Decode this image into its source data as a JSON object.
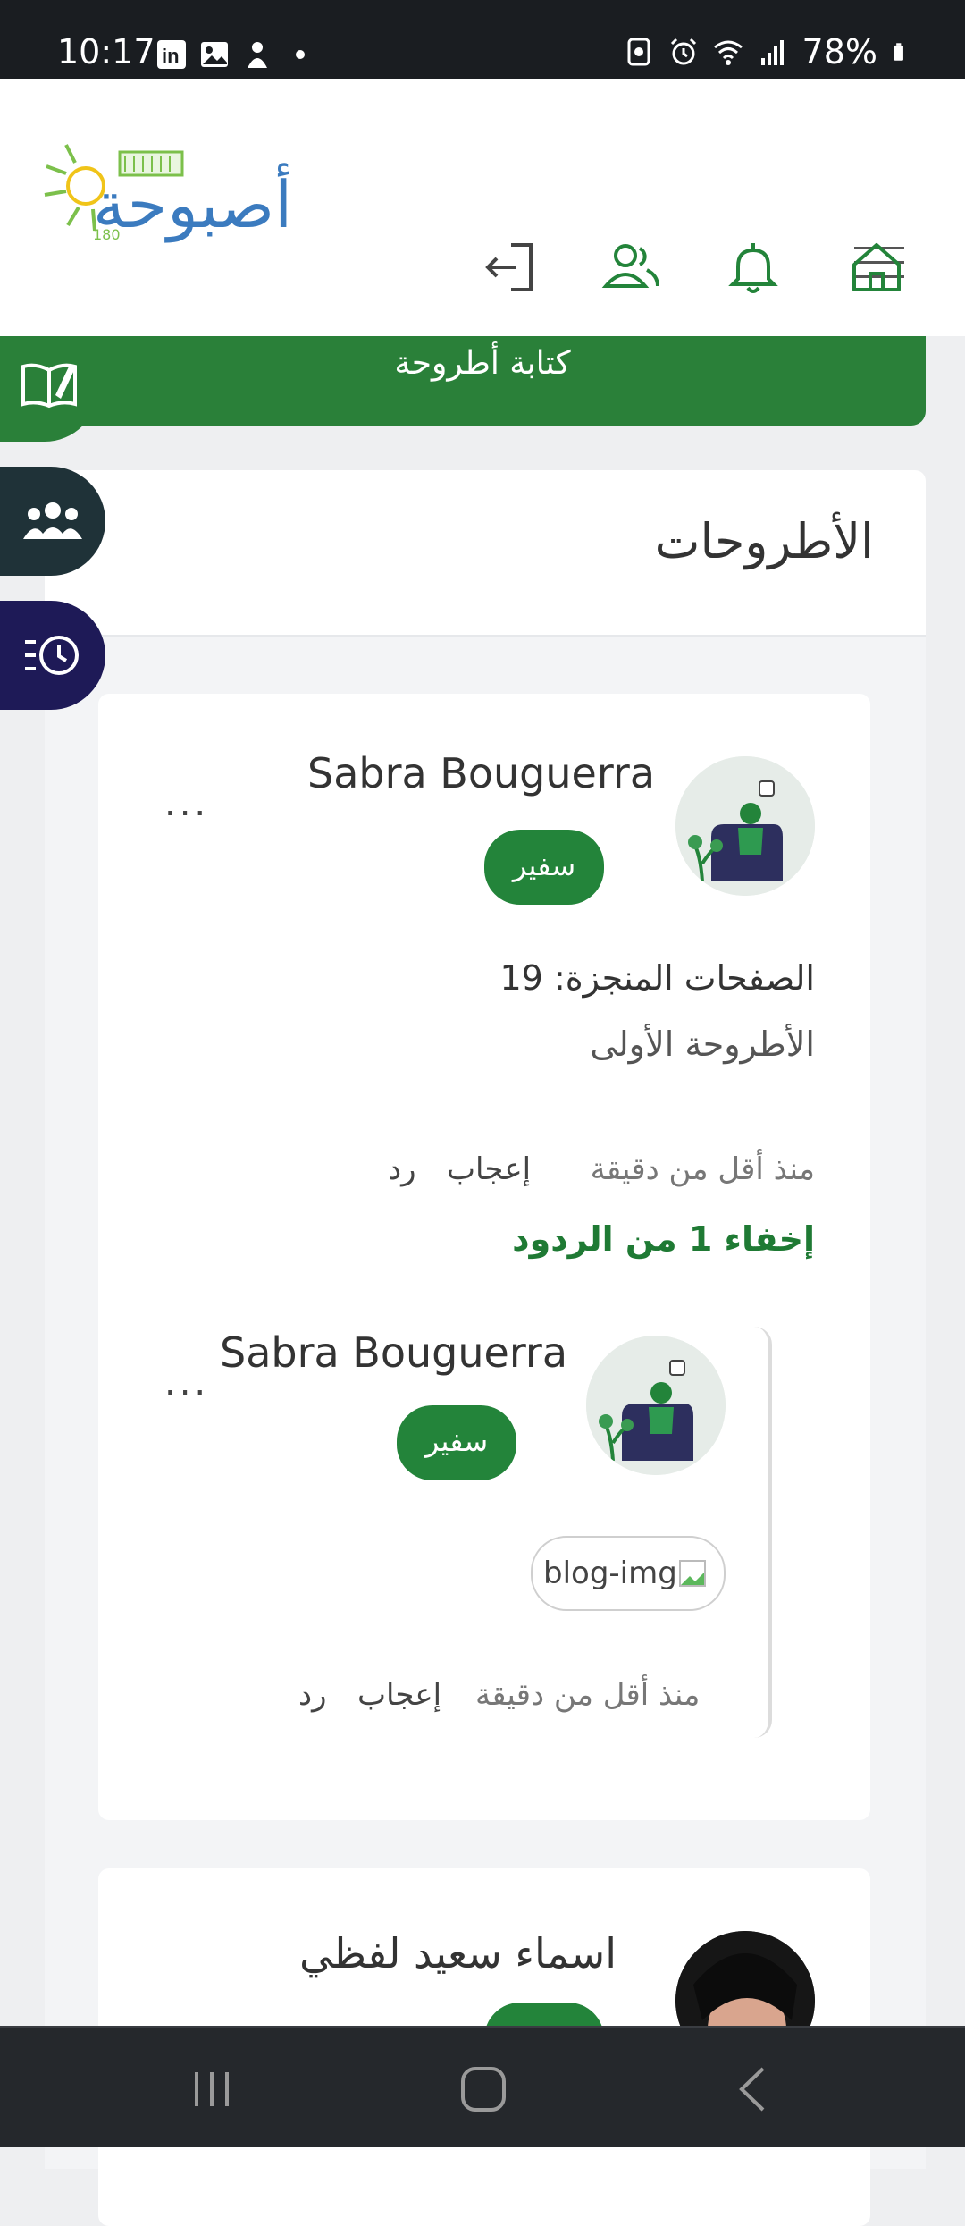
{
  "status_bar": {
    "time": "10:17",
    "battery": "78%",
    "left_icons": [
      "linkedin-icon",
      "gallery-icon",
      "app-icon",
      "dot-icon"
    ],
    "right_icons": [
      "nfc-icon",
      "alarm-icon",
      "wifi-icon",
      "signal-icon",
      "battery-icon"
    ]
  },
  "header": {
    "logo_text": "أصبوحة",
    "logo_subtext": "180",
    "nav_icons": [
      "logout-icon",
      "friends-icon",
      "bell-icon",
      "home-icon"
    ],
    "menu_icon": "hamburger-menu-icon"
  },
  "write_banner": {
    "label": "كتابة أطروحة",
    "icon": "book-icon"
  },
  "side_tabs": [
    {
      "icon": "group-icon",
      "color": "#1f3238"
    },
    {
      "icon": "history-icon",
      "color": "#1e1a57"
    }
  ],
  "main": {
    "title": "الأطروحات",
    "post": {
      "author": "Sabra Bouguerra",
      "badge": "سفير",
      "more": "...",
      "pages_done": "الصفحات المنجزة: 19",
      "thesis_title": "الأطروحة الأولى",
      "time": "منذ أقل من دقيقة",
      "like": "إعجاب",
      "reply": "رد",
      "toggle_replies": "إخفاء 1 من الردود",
      "reply_item": {
        "author": "Sabra Bouguerra",
        "badge": "سفير",
        "more": "...",
        "image_alt": "blog-img",
        "time": "منذ أقل من دقيقة",
        "like": "إعجاب",
        "reply": "رد"
      }
    },
    "post2": {
      "author": "اسماء سعيد لفظي"
    }
  },
  "colors": {
    "accent": "#23843a",
    "banner": "#2a8039",
    "dark_teal": "#1f3238",
    "dark_navy": "#1e1a57",
    "status_bar": "#1a1d21",
    "nav_bar": "#25282c"
  }
}
